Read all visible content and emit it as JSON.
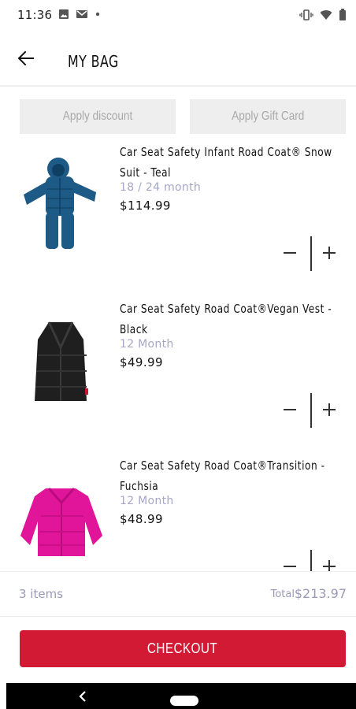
{
  "status_bar": {
    "time": "11:36",
    "left_icons": [
      "image-icon",
      "gmail-icon",
      "dot-icon"
    ],
    "right_icons": [
      "vibrate-icon",
      "wifi-icon",
      "battery-icon"
    ]
  },
  "header": {
    "title": "MY BAG",
    "back_icon": "arrow-left-icon"
  },
  "promo": {
    "discount_label": "Apply discount",
    "gift_card_label": "Apply Gift Card"
  },
  "items": [
    {
      "name_line1": "Car Seat Safety Infant Road Coat® Snow",
      "name_line2": "Suit - Teal",
      "size": "18 / 24 month",
      "price": "$114.99",
      "color": "#1d5a86"
    },
    {
      "name_line1": "Car Seat Safety Road Coat®Vegan Vest -",
      "name_line2": "Black",
      "size": "12 Month",
      "price": "$49.99",
      "color": "#1f1f1f"
    },
    {
      "name_line1": "Car Seat Safety Road Coat®Transition  -",
      "name_line2": "Fuchsia",
      "size": "12 Month",
      "price": "$48.99",
      "color": "#e0159a"
    }
  ],
  "summary": {
    "count": "3 items",
    "total_label": "Total",
    "total_value": "$213.97"
  },
  "checkout": {
    "label": "CHECKOUT",
    "color": "#d21a35"
  },
  "nav": {
    "back_icon": "nav-back-icon",
    "home_icon": "nav-home-pill"
  }
}
